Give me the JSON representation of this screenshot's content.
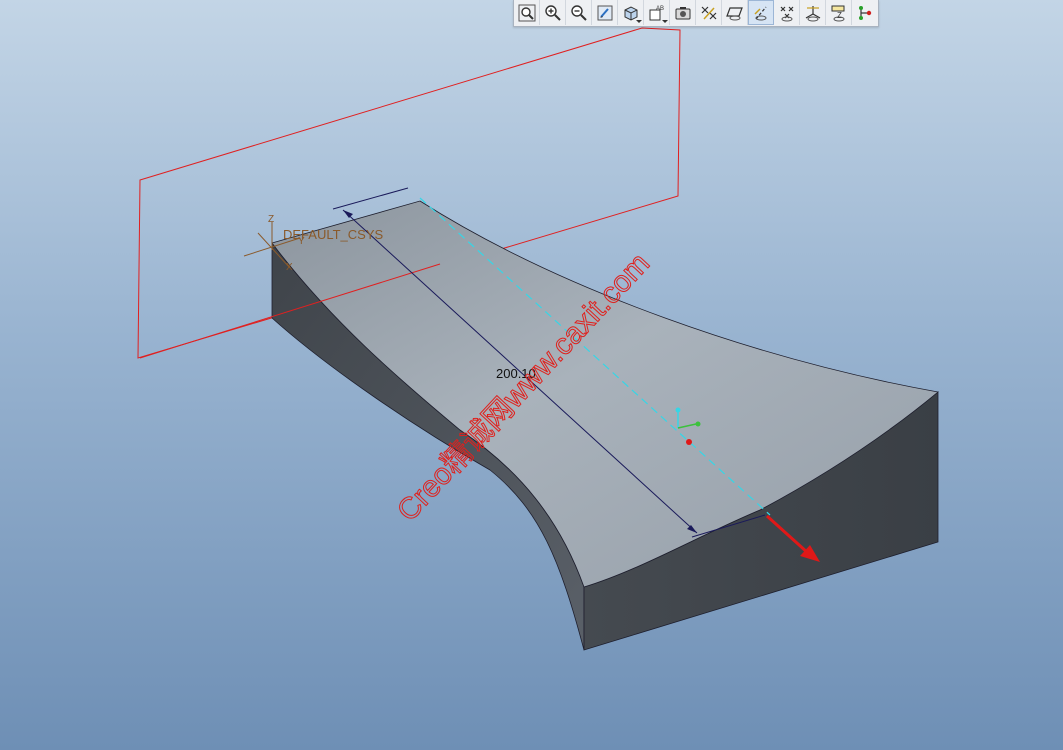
{
  "toolbar": {
    "buttons": [
      {
        "id": "refit",
        "icon": "zoom-fit-icon"
      },
      {
        "id": "zoom-in",
        "icon": "zoom-in-icon"
      },
      {
        "id": "zoom-out",
        "icon": "zoom-out-icon"
      },
      {
        "id": "repaint",
        "icon": "repaint-icon"
      },
      {
        "id": "display-style",
        "icon": "shaded-cube-icon"
      },
      {
        "id": "saved-views",
        "icon": "saved-views-icon"
      },
      {
        "id": "view-manager",
        "icon": "view-manager-icon"
      },
      {
        "id": "datum-display",
        "icon": "datum-display-icon"
      },
      {
        "id": "plane-display",
        "icon": "plane-display-icon"
      },
      {
        "id": "axis-display",
        "icon": "axis-display-icon"
      },
      {
        "id": "point-display",
        "icon": "point-display-icon"
      },
      {
        "id": "csys-display",
        "icon": "csys-display-icon"
      },
      {
        "id": "annotation-display",
        "icon": "annotation-display-icon"
      },
      {
        "id": "spin-center",
        "icon": "spin-center-icon"
      }
    ]
  },
  "scene": {
    "csys_label": "DEFAULT_CSYS",
    "csys_axes": {
      "z": "Z",
      "y": "Y",
      "x": "X"
    },
    "dimension_value": "200.10",
    "watermark": "Creo精诚网www.caxit.com",
    "colors": {
      "datum_plane": "#e02020",
      "axis_line": "#36d6e6",
      "dimension": "#1a1a5a",
      "top_face": "#a2abb4",
      "side_face_dark": "#4a4f55",
      "watermark": "#e0201c",
      "drag_arrow": "#e01818"
    }
  }
}
